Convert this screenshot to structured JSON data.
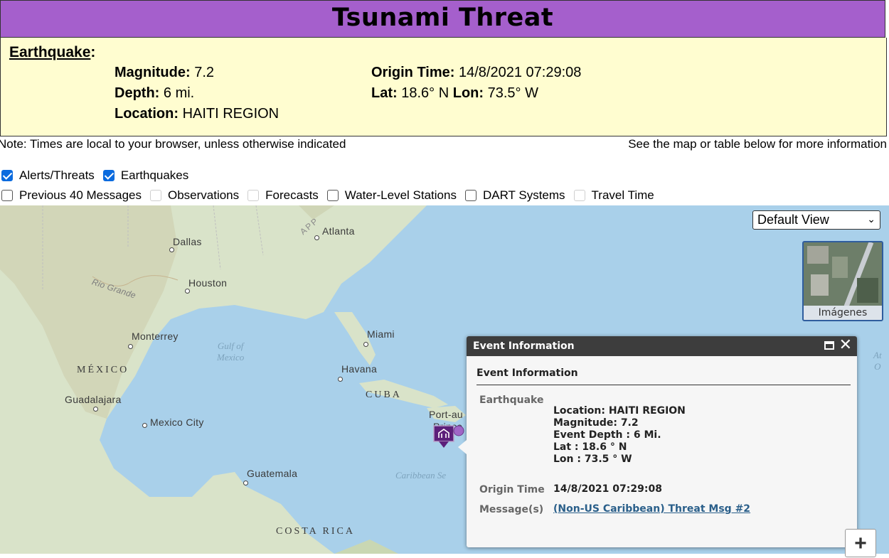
{
  "banner": {
    "title": "Tsunami Threat"
  },
  "earthquake": {
    "heading": "Earthquake",
    "magnitude_label": "Magnitude:",
    "magnitude": "7.2",
    "depth_label": "Depth:",
    "depth": "6 mi.",
    "location_label": "Location:",
    "location": "HAITI REGION",
    "origin_label": "Origin Time:",
    "origin_time": "14/8/2021 07:29:08",
    "lat_label": "Lat:",
    "lat": "18.6° N",
    "lon_label": "Lon:",
    "lon": "73.5° W"
  },
  "notes": {
    "left": "Note: Times are local to your browser, unless otherwise indicated",
    "right": "See the map or table below for more information"
  },
  "layers": {
    "row1": [
      {
        "label": "Alerts/Threats",
        "checked": true
      },
      {
        "label": "Earthquakes",
        "checked": true
      }
    ],
    "row2": [
      {
        "label": "Previous 40 Messages",
        "checked": false,
        "disabled": false
      },
      {
        "label": "Observations",
        "checked": false,
        "disabled": true
      },
      {
        "label": "Forecasts",
        "checked": false,
        "disabled": true
      },
      {
        "label": "Water-Level Stations",
        "checked": false,
        "disabled": false
      },
      {
        "label": "DART Systems",
        "checked": false,
        "disabled": false
      },
      {
        "label": "Travel Time",
        "checked": false,
        "disabled": true
      }
    ]
  },
  "map": {
    "view_select": "Default View",
    "basemap_label": "Imágenes",
    "cities": {
      "dallas": "Dallas",
      "atlanta": "Atlanta",
      "houston": "Houston",
      "monterrey": "Monterrey",
      "miami": "Miami",
      "havana": "Havana",
      "guadalajara": "Guadalajara",
      "mexico_city": "Mexico City",
      "guatemala": "Guatemala",
      "port_au": "Port-au",
      "prince": "Prince"
    },
    "regions": {
      "mexico": "MÉXICO",
      "cuba": "CUBA",
      "costa_rica": "COSTA RICA",
      "rio_grande": "Rio Grande",
      "appalachian": "APP"
    },
    "water": {
      "gulf_1": "Gulf of",
      "gulf_2": "Mexico",
      "caribbean": "Caribbean Se",
      "atlantic_1": "At",
      "atlantic_2": "O"
    },
    "zoom_in": "+"
  },
  "popup": {
    "title": "Event Information",
    "subtitle": "Event Information",
    "eq_key": "Earthquake",
    "location_line": "Location: HAITI REGION",
    "magnitude_line": "Magnitude: 7.2",
    "depth_line": "Event Depth : 6 Mi.",
    "lat_line": "Lat : 18.6 ° N",
    "lon_line": "Lon : 73.5 ° W",
    "origin_key": "Origin Time",
    "origin_val": "14/8/2021 07:29:08",
    "msg_key": "Message(s)",
    "msg_link": "(Non-US Caribbean) Threat Msg #2"
  }
}
